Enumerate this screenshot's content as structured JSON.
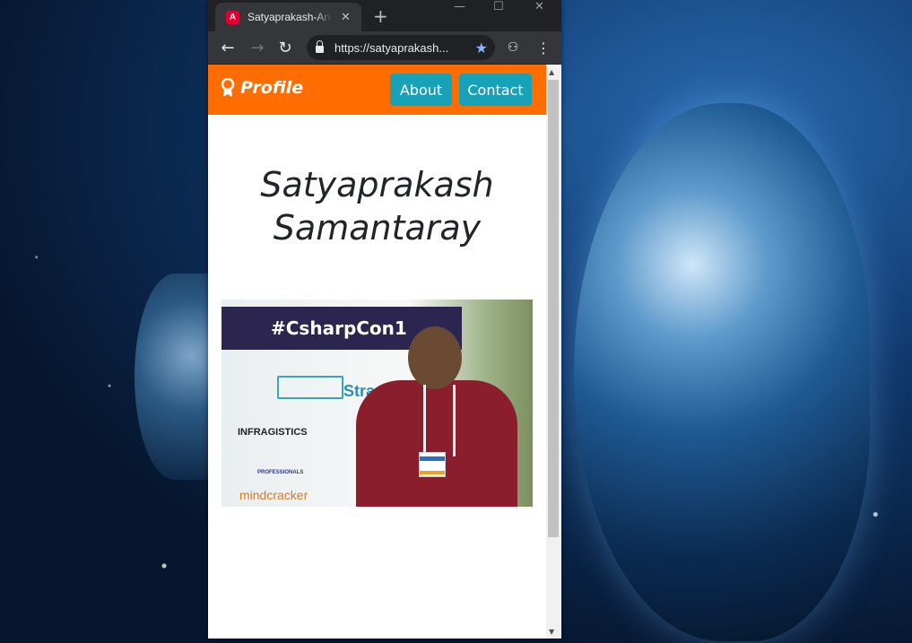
{
  "tab": {
    "title": "Satyaprakash-Angular",
    "favicon_letter": "A"
  },
  "address_bar": {
    "url": "https://satyaprakash..."
  },
  "window_controls": {
    "minimize": "—",
    "maximize": "☐",
    "close": "✕"
  },
  "navbar": {
    "brand": "Profile",
    "links": [
      "About",
      "Contact"
    ],
    "background": "#ff6d00",
    "button_color": "#17a2b8"
  },
  "page": {
    "heading_line1": "Satyaprakash",
    "heading_line2": "Samantaray"
  },
  "photo": {
    "banner_text": "#CsharpCon1",
    "sponsor1": "Stra",
    "sponsor2": "INFRAGISTICS",
    "sponsor3": "PROFESSIONALS",
    "sponsor4": "mindcracker"
  }
}
